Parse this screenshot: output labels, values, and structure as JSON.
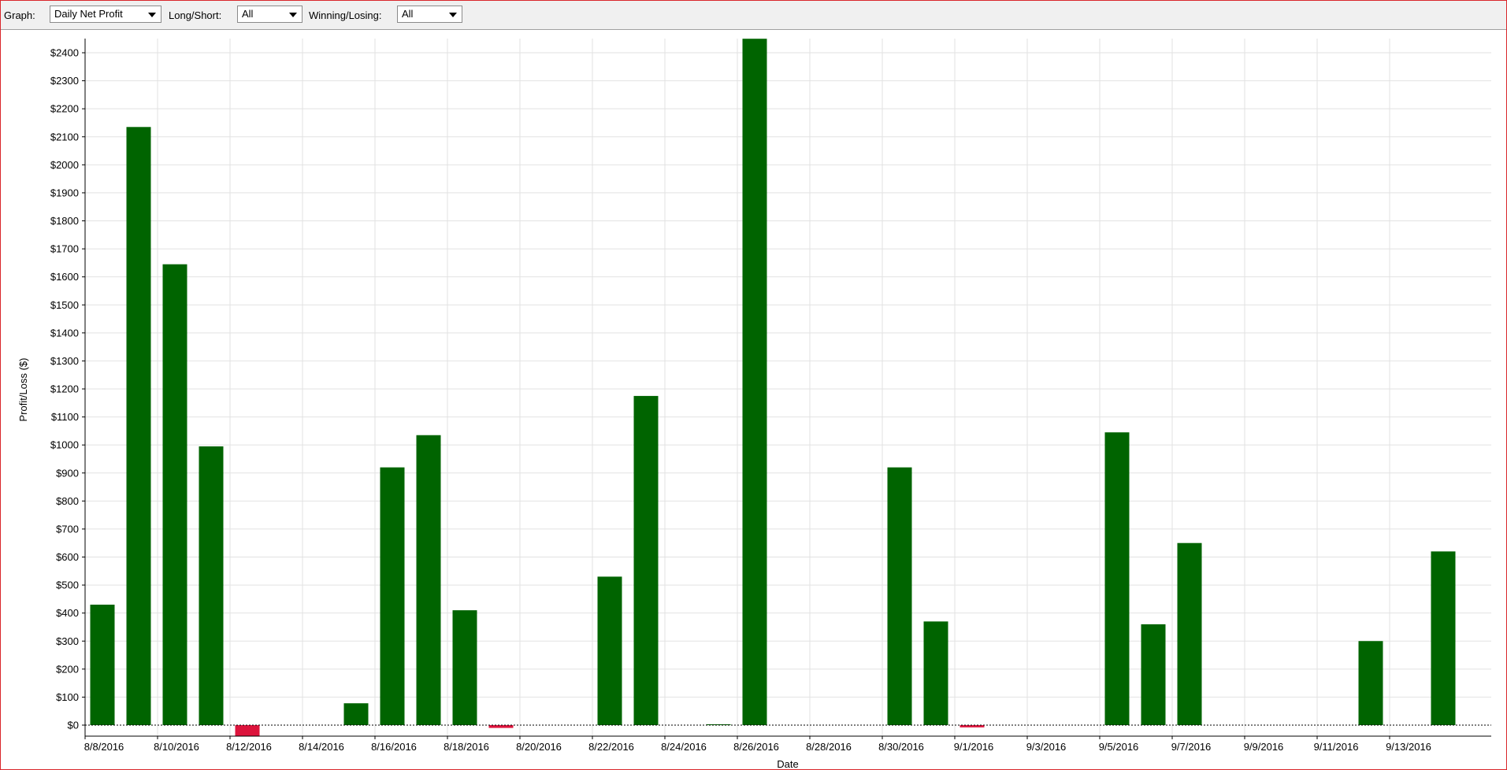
{
  "toolbar": {
    "graph_label": "Graph:",
    "graph_value": "Daily Net Profit",
    "longshort_label": "Long/Short:",
    "longshort_value": "All",
    "winlose_label": "Winning/Losing:",
    "winlose_value": "All"
  },
  "chart_data": {
    "type": "bar",
    "xlabel": "Date",
    "ylabel": "Profit/Loss ($)",
    "ylim": [
      -40,
      2450
    ],
    "yticks": [
      0,
      100,
      200,
      300,
      400,
      500,
      600,
      700,
      800,
      900,
      1000,
      1100,
      1200,
      1300,
      1400,
      1500,
      1600,
      1700,
      1800,
      1900,
      2000,
      2100,
      2200,
      2300,
      2400
    ],
    "ytick_prefix": "$",
    "xticks": [
      "8/8/2016",
      "8/10/2016",
      "8/12/2016",
      "8/14/2016",
      "8/16/2016",
      "8/18/2016",
      "8/20/2016",
      "8/22/2016",
      "8/24/2016",
      "8/26/2016",
      "8/28/2016",
      "8/30/2016",
      "9/1/2016",
      "9/3/2016",
      "9/5/2016",
      "9/7/2016",
      "9/9/2016",
      "9/11/2016",
      "9/13/2016"
    ],
    "x_start": "8/8/2016",
    "x": [
      "8/8/2016",
      "8/9/2016",
      "8/10/2016",
      "8/11/2016",
      "8/12/2016",
      "8/15/2016",
      "8/16/2016",
      "8/17/2016",
      "8/18/2016",
      "8/19/2016",
      "8/22/2016",
      "8/23/2016",
      "8/25/2016",
      "8/26/2016",
      "8/30/2016",
      "8/31/2016",
      "9/1/2016",
      "9/5/2016",
      "9/6/2016",
      "9/7/2016",
      "9/12/2016",
      "9/14/2016"
    ],
    "values": [
      430,
      2135,
      1645,
      995,
      -38,
      78,
      920,
      1035,
      410,
      -10,
      530,
      1175,
      3,
      2450,
      920,
      370,
      -8,
      1045,
      360,
      650,
      300,
      620
    ],
    "colors": {
      "positive": "#006400",
      "negative": "#dc143c"
    },
    "grid": true
  }
}
